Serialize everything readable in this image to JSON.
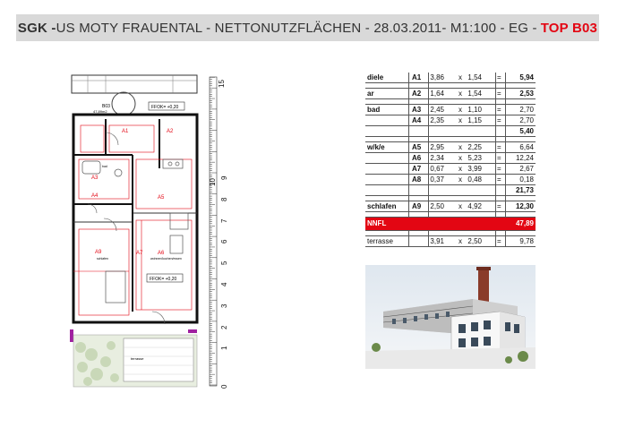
{
  "header": {
    "brand": "SGK - ",
    "title": "US MOTY FRAUENTAL - NETTONUTZFLÄCHEN - 28.03.2011- M1:100 - EG - ",
    "unit": "TOP B03"
  },
  "plan": {
    "unit_label": "B03",
    "unit_area": "47,89m2",
    "ffok_top": "FFOK= +0,20",
    "ffok_bottom": "FFOK= +0,20",
    "rooms": [
      {
        "code": "A1",
        "name": "diele"
      },
      {
        "code": "A2",
        "name": "ar"
      },
      {
        "code": "A3",
        "name": "bad"
      },
      {
        "code": "A4",
        "name": ""
      },
      {
        "code": "A5",
        "name": ""
      },
      {
        "code": "A6",
        "name": "wohnen/kochen/essen"
      },
      {
        "code": "A7",
        "name": ""
      },
      {
        "code": "A9",
        "name": "schlafen"
      }
    ],
    "terrace": "terrasse",
    "scale_ticks": [
      "0",
      "1",
      "2",
      "3",
      "4",
      "5",
      "6",
      "7",
      "8",
      "9",
      "10",
      "15"
    ]
  },
  "table": {
    "rows": [
      {
        "name": "diele",
        "code": "A1",
        "a": "3,86",
        "x": "x",
        "b": "1,54",
        "eq": "=",
        "r": "5,94",
        "bold": true
      },
      {
        "blank": true
      },
      {
        "name": "ar",
        "code": "A2",
        "a": "1,64",
        "x": "x",
        "b": "1,54",
        "eq": "=",
        "r": "2,53",
        "bold": true
      },
      {
        "blank": true
      },
      {
        "name": "bad",
        "code": "A3",
        "a": "2,45",
        "x": "x",
        "b": "1,10",
        "eq": "=",
        "r": "2,70"
      },
      {
        "name": "",
        "code": "A4",
        "a": "2,35",
        "x": "x",
        "b": "1,15",
        "eq": "=",
        "r": "2,70"
      },
      {
        "name": "",
        "code": "",
        "a": "",
        "x": "",
        "b": "",
        "eq": "",
        "r": "5,40",
        "bold": true
      },
      {
        "blank": true
      },
      {
        "name": "w/k/e",
        "code": "A5",
        "a": "2,95",
        "x": "x",
        "b": "2,25",
        "eq": "=",
        "r": "6,64"
      },
      {
        "name": "",
        "code": "A6",
        "a": "2,34",
        "x": "x",
        "b": "5,23",
        "eq": "=",
        "r": "12,24"
      },
      {
        "name": "",
        "code": "A7",
        "a": "0,67",
        "x": "x",
        "b": "3,99",
        "eq": "=",
        "r": "2,67"
      },
      {
        "name": "",
        "code": "A8",
        "a": "0,37",
        "x": "x",
        "b": "0,48",
        "eq": "=",
        "r": "0,18"
      },
      {
        "name": "",
        "code": "",
        "a": "",
        "x": "",
        "b": "",
        "eq": "",
        "r": "21,73",
        "bold": true
      },
      {
        "blank": true
      },
      {
        "name": "schlafen",
        "code": "A9",
        "a": "2,50",
        "x": "x",
        "b": "4,92",
        "eq": "=",
        "r": "12,30",
        "bold": true
      },
      {
        "blank": true
      }
    ],
    "total": {
      "name": "NNFL",
      "r": "47,89"
    },
    "terrace": {
      "name": "terrasse",
      "a": "3,91",
      "x": "x",
      "b": "2,50",
      "eq": "=",
      "r": "9,78"
    }
  },
  "colors": {
    "accent": "#e30613",
    "header_bg": "#d9d9d9"
  }
}
